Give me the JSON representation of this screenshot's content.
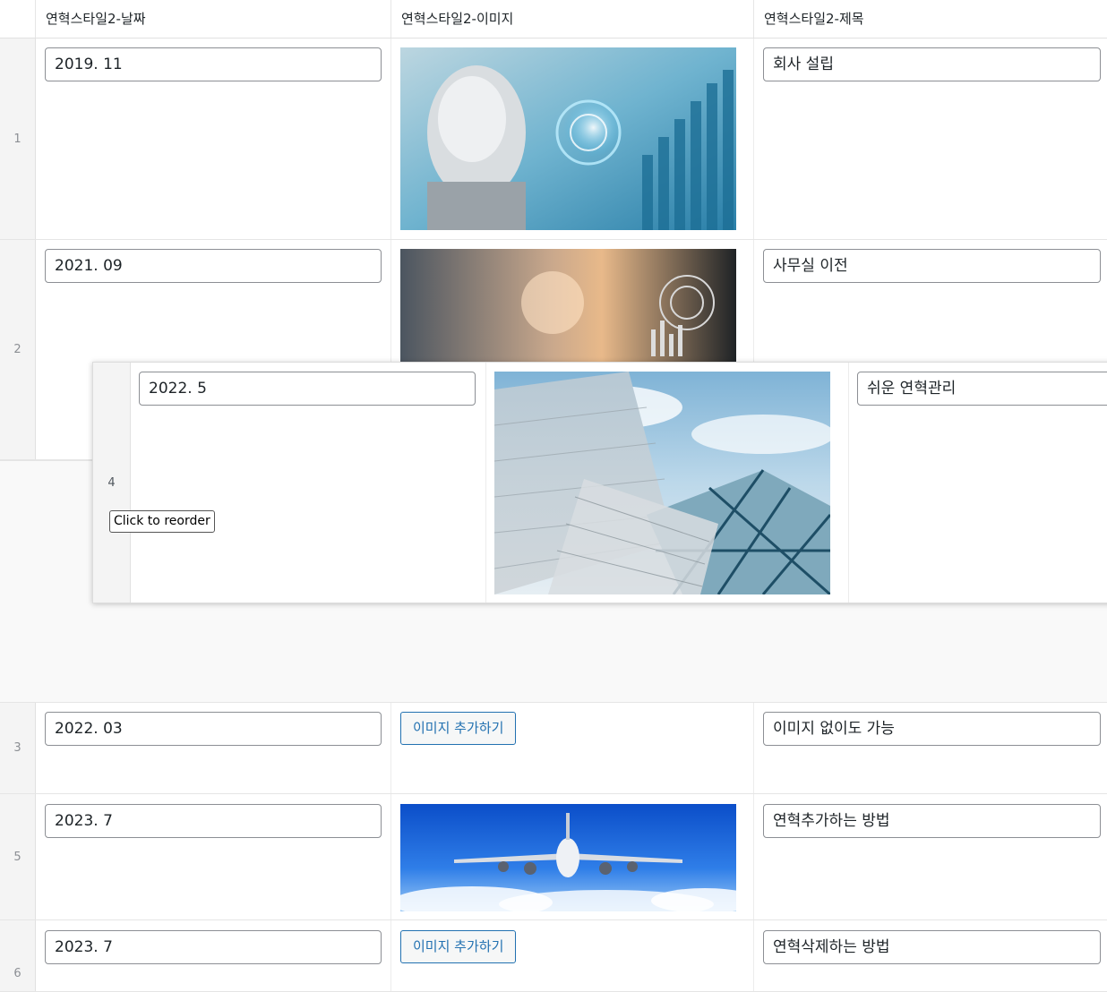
{
  "header": {
    "col_date": "연혁스타일2-날짜",
    "col_image": "연혁스타일2-이미지",
    "col_title": "연혁스타일2-제목"
  },
  "rows": [
    {
      "num": "1",
      "date": "2019. 11",
      "title": "회사 설립",
      "image": "robot-tech"
    },
    {
      "num": "2",
      "date": "2021. 09",
      "title": "사무실 이전",
      "image": "business-tech"
    },
    {
      "num": "3",
      "date": "2022. 03",
      "title": "이미지 없이도 가능",
      "button": "이미지 추가하기"
    },
    {
      "num": "5",
      "date": "2023. 7",
      "title": "연혁추가하는 방법",
      "image": "airplane"
    },
    {
      "num": "6",
      "date": "2023. 7",
      "title": "연혁삭제하는 방법",
      "button": "이미지 추가하기"
    }
  ],
  "dragging_row": {
    "num": "4",
    "date": "2022. 5",
    "title": "쉬운 연혁관리",
    "image": "glass-building"
  },
  "tooltip": "Click to reorder",
  "colors": {
    "accent": "#2271b1",
    "border": "#8c8f94",
    "row_num_bg": "#f4f4f4"
  }
}
